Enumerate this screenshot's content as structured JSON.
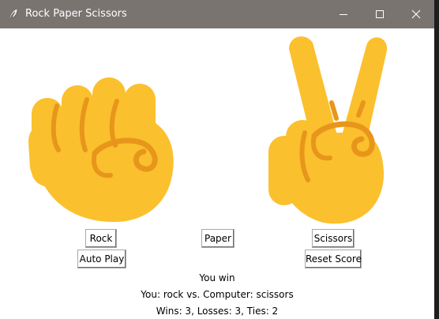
{
  "window": {
    "title": "Rock Paper Scissors",
    "controls": {
      "minimize": "minimize-icon",
      "maximize": "maximize-icon",
      "close": "close-icon"
    }
  },
  "choices": {
    "player_hand": "rock-fist-emoji",
    "computer_hand": "victory-hand-emoji"
  },
  "buttons": {
    "rock": "Rock",
    "paper": "Paper",
    "scissors": "Scissors",
    "auto_play": "Auto Play",
    "reset_score": "Reset Score"
  },
  "result": {
    "outcome": "You win",
    "moves": "You: rock vs. Computer: scissors",
    "score": "Wins: 3, Losses: 3, Ties: 2"
  },
  "colors": {
    "titlebar": "#7a7471",
    "hand_fill": "#fbc02d",
    "hand_crease": "#e8961b"
  }
}
